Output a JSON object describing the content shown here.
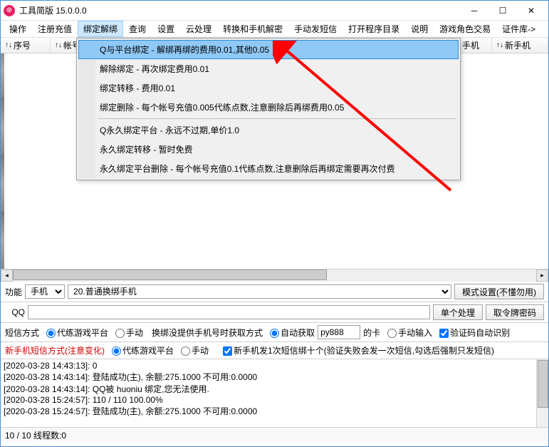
{
  "window": {
    "title": "工具简版  15.0.0.0"
  },
  "menubar": [
    "操作",
    "注册充值",
    "绑定解绑",
    "查询",
    "设置",
    "云处理",
    "转换和手机解密",
    "手动发短信",
    "打开程序目录",
    "说明",
    "游戏角色交易",
    "证件库->"
  ],
  "menubar_active_index": 2,
  "columns": [
    "↑↓序号",
    "↑↓帐号",
    "↑↓手机",
    "↑↓新手机"
  ],
  "dropdown": {
    "items_top": [
      "Q与平台绑定 - 解绑再绑的费用0.01,其他0.05",
      "解除绑定 - 再次绑定费用0.01",
      "绑定转移 - 费用0.01",
      "绑定删除 - 每个帐号充值0.005代练点数,注意删除后再绑费用0.05"
    ],
    "items_bottom": [
      "Q永久绑定平台 - 永远不过期,单价1.0",
      "永久绑定转移 - 暂时免费",
      "永久绑定平台删除 - 每个帐号充值0.1代练点数,注意删除后再绑定需要再次付费"
    ],
    "selected_index": 0
  },
  "func_row": {
    "label": "功能",
    "select1": "手机",
    "select2": "20.普通换绑手机",
    "mode_btn": "模式设置(不懂勿用)"
  },
  "qq_row": {
    "label": "QQ",
    "value": "",
    "btn1": "单个处理",
    "btn2": "取令牌密码"
  },
  "sms_row": {
    "label": "短信方式",
    "opt1": "代练游戏平台",
    "opt2": "手动",
    "label2": "换绑没提供手机号时获取方式",
    "opt3": "自动获取",
    "input": "py888",
    "label3": "的卡",
    "opt4": "手动输入",
    "chk": "验证码自动识别"
  },
  "newphone_row": {
    "label": "新手机短信方式(注意变化)",
    "opt1": "代练游戏平台",
    "opt2": "手动",
    "chk": "新手机发1次短信绑十个(验证失败会发一次短信,勾选后强制只发短信)"
  },
  "log": [
    "[2020-03-28 14:43:13]: 0",
    "[2020-03-28 14:43:14]: 登陆成功(主), 余额:275.1000 不可用:0.0000",
    "[2020-03-28 14:43:14]: QQ被 huoniu 绑定,您无法使用.",
    "[2020-03-28 15:24:57]: 110 / 110 100.00%",
    "[2020-03-28 15:24:57]: 登陆成功(主), 余额:275.1000 不可用:0.0000"
  ],
  "status": "10 / 10 线程数:0"
}
